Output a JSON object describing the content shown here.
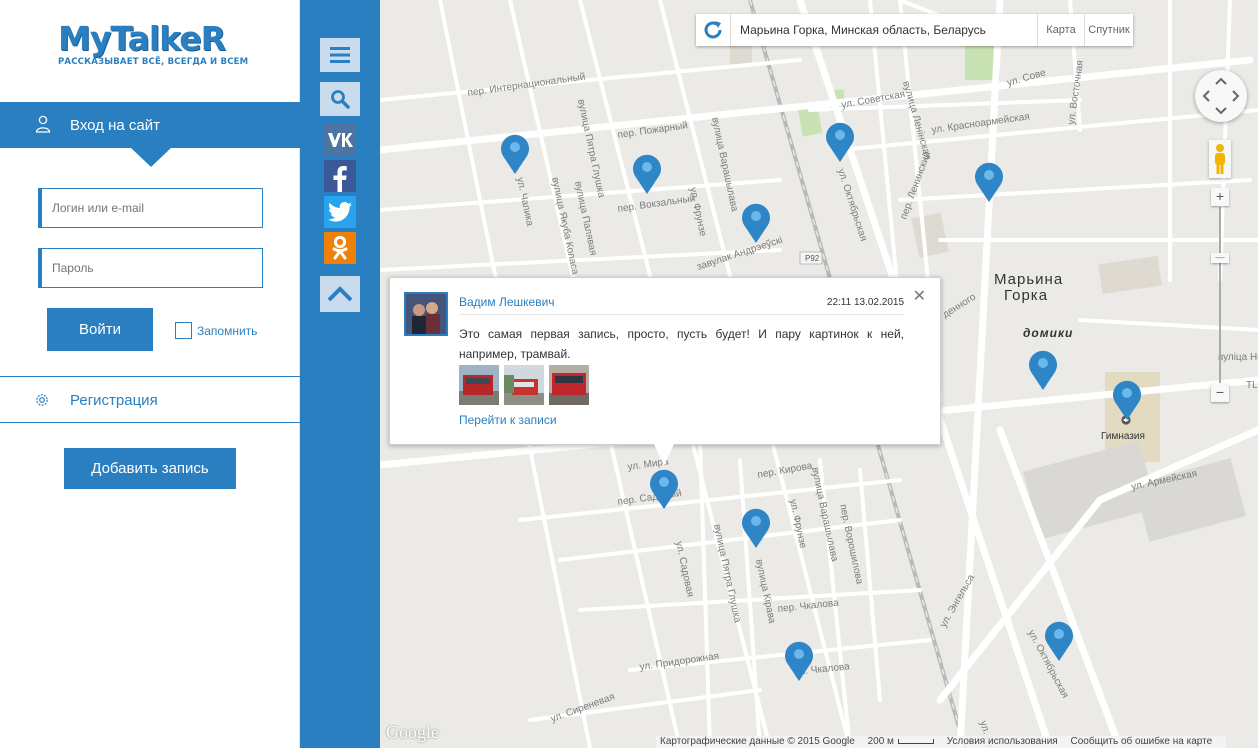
{
  "logo": {
    "title": "MyTalkeR",
    "tagline": "РАССКАЗЫВАЕТ ВСЁ, ВСЕГДА И ВСЕМ"
  },
  "login": {
    "heading": "Вход на сайт",
    "login_placeholder": "Логин или e-mail",
    "password_placeholder": "Пароль",
    "submit_label": "Войти",
    "remember_label": "Запомнить"
  },
  "register": {
    "label": "Регистрация"
  },
  "add_post_label": "Добавить запись",
  "toolbar": {
    "icons": [
      "menu-icon",
      "search-icon",
      "vk-icon",
      "facebook-icon",
      "twitter-icon",
      "odnoklassniki-icon",
      "scroll-up-icon"
    ],
    "colors": {
      "accent": "#2a7fc0",
      "vk": "#4c75a3",
      "facebook": "#3b5998",
      "twitter": "#2aa3ef",
      "odnoklassniki": "#ee8208"
    }
  },
  "map": {
    "search_value": "Марьина Горка, Минская область, Беларусь",
    "map_type": {
      "map": "Карта",
      "satellite": "Спутник"
    },
    "place_name_line1": "Марьина",
    "place_name_line2": "Горка",
    "district": "домики",
    "gymnasium": "Гимназия",
    "highway": "P92",
    "streets": {
      "internatsionalny": "пер. Интернациональный",
      "pozharny": "пер. Пожарный",
      "vokzalny": "пер. Вокзальный",
      "petra_gluhka": "вулица Пятра Глушка",
      "yakuba_kolasa": "вулица Якуба Коласа",
      "palevaya": "вулица Палявая",
      "chapika": "ул. Чапика",
      "varashylava": "вулица Варашылава",
      "frunze": "ул. Фрунзе",
      "andreevski": "завулак Андрэеўскі",
      "sovetskaya": "ул. Советская",
      "krasnoarmeyskaya": "ул. Красноармейская",
      "leninskaya": "вулица Ленінская",
      "lenina_per": "пер. Ленинский",
      "oktyabrskaya": "ул. Октябрьская",
      "sovetskaya2": "ул. Сове",
      "vostochnaya": "ул. Восточная",
      "mira": "ул. Мира",
      "sadovaya_per": "пер. Садовый",
      "kirova": "пер. Кирова",
      "sadovaya": "ул. Садовая",
      "petra_gluhka2": "вулица Пятра Глушка",
      "kirava": "вулица Кірава",
      "frunze2": "ул. Фрунзе",
      "varashylava2": "вулица Варашылава",
      "voroshilova_per": "пер. Ворошилова",
      "chkalova_per": "пер. Чкалова",
      "chkalova": "ул. Чкалова",
      "pridorozhnaya": "ул. Придорожная",
      "sirenevaya": "ул. Сиреневая",
      "engelsa": "ул. Энгельса",
      "oktyabrskaya2": "ул. Октябрьская",
      "armeyskaya": "ул. Армейская",
      "vulitsa_no": "вуліца Но",
      "pushk": "ул. Пушк",
      "tl": "TL",
      "dennogo": "денного"
    },
    "attribution": {
      "data": "Картографические данные © 2015 Google",
      "scale": "200 м",
      "terms": "Условия использования",
      "report": "Сообщить об ошибке на карте"
    },
    "google": "Google",
    "pin_color": "#2e86c7"
  },
  "popup": {
    "author": "Вадим Лешкевич",
    "time": "22:11 13.02.2015",
    "text": "Это самая первая запись, просто, пусть будет! И пару картинок к ней, например, трамвай.",
    "link": "Перейти к записи",
    "thumbnails": [
      "tram-photo-1",
      "tram-photo-2",
      "tram-photo-3"
    ],
    "close_icon": "close-icon"
  }
}
